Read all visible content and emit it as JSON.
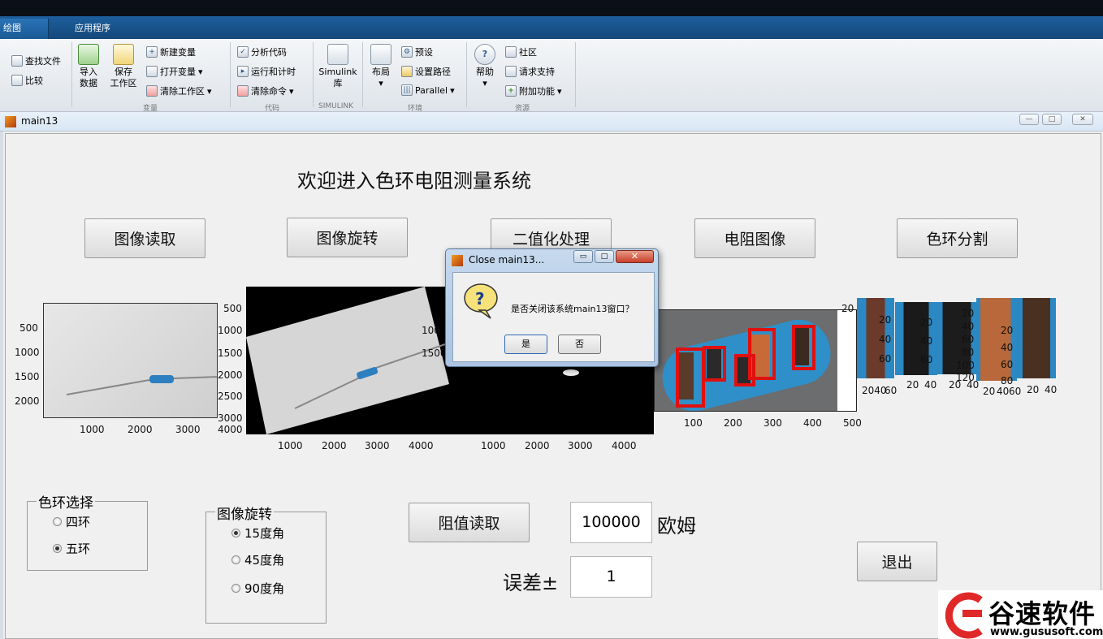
{
  "toolstrip": {
    "tabs": [
      "绘图",
      "应用程序"
    ],
    "file": {
      "find_files": "查找文件",
      "compare": "比较"
    },
    "variable": {
      "import": "导入\n数据",
      "save_workspace": "保存\n工作区",
      "new_variable": "新建变量",
      "open_variable": "打开变量",
      "clear_workspace": "清除工作区",
      "group": "变量"
    },
    "code": {
      "analyze": "分析代码",
      "run_time": "运行和计时",
      "clear_commands": "清除命令",
      "group": "代码"
    },
    "simulink": {
      "label": "Simulink\n库",
      "group": "SIMULINK"
    },
    "environment": {
      "layout": "布局",
      "preferences": "预设",
      "set_path": "设置路径",
      "parallel": "Parallel",
      "group": "环境"
    },
    "resources": {
      "help": "帮助",
      "community": "社区",
      "request_support": "请求支持",
      "addons": "附加功能",
      "group": "资源"
    }
  },
  "figure": {
    "window_title": "main13",
    "window_buttons": [
      "—",
      "□",
      "✕"
    ],
    "heading": "欢迎进入色环电阻测量系统",
    "buttons": {
      "read_image": "图像读取",
      "rotate_image": "图像旋转",
      "binarize": "二值化处理",
      "resistor_image": "电阻图像",
      "band_segment": "色环分割",
      "read_value": "阻值读取",
      "exit": "退出"
    },
    "axes1": {
      "y_ticks": [
        "500",
        "1000",
        "1500",
        "2000"
      ],
      "x_ticks": [
        "1000",
        "2000",
        "3000"
      ]
    },
    "axes2": {
      "y_ticks": [
        "500",
        "1000",
        "1500",
        "2000",
        "2500",
        "3000"
      ],
      "x_ticks": [
        "1000",
        "2000",
        "3000",
        "4000"
      ]
    },
    "axes3": {
      "y_ticks": [
        "100",
        "1500"
      ],
      "x_ticks": [
        "1000",
        "2000",
        "3000",
        "4000"
      ]
    },
    "axes4": {
      "y_ticks": [
        "20"
      ],
      "x_ticks": [
        "100",
        "200",
        "300",
        "400",
        "500"
      ]
    },
    "segments": [
      {
        "y_ticks": [
          "20",
          "40",
          "60"
        ],
        "x_ticks": [
          "2040",
          "60"
        ]
      },
      {
        "y_ticks": [
          "20",
          "40",
          "60"
        ],
        "x_ticks": [
          "20",
          "40"
        ]
      },
      {
        "y_ticks": [
          "20",
          "40",
          "60",
          "80",
          "100",
          "120"
        ],
        "x_ticks": [
          "20",
          "40"
        ]
      },
      {
        "y_ticks": [
          "20",
          "40",
          "60",
          "80"
        ],
        "x_ticks": [
          "20",
          "40",
          "60"
        ]
      },
      {
        "y_ticks": [],
        "x_ticks": [
          "20",
          "40"
        ]
      }
    ],
    "band_group": {
      "title": "色环选择",
      "options": [
        {
          "label": "四环",
          "selected": false
        },
        {
          "label": "五环",
          "selected": true
        }
      ]
    },
    "rotate_group": {
      "title": "图像旋转",
      "options": [
        {
          "label": "15度角",
          "selected": true
        },
        {
          "label": "45度角",
          "selected": false
        },
        {
          "label": "90度角",
          "selected": false
        }
      ]
    },
    "resistance_value": "100000",
    "resistance_unit": "欧姆",
    "tolerance_label": "误差±",
    "tolerance_value": "1"
  },
  "dialog": {
    "title": "Close main13...",
    "message": "是否关闭该系统main13窗口？",
    "yes": "是",
    "no": "否",
    "icon": "question-icon"
  },
  "watermark": {
    "name": "谷速软件",
    "url": "www.gususoft.com"
  }
}
